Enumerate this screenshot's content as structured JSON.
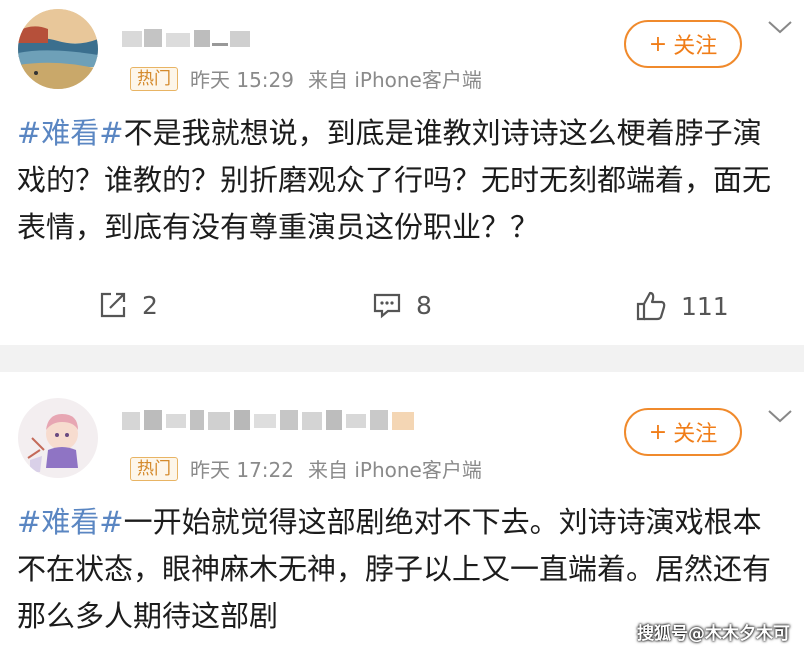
{
  "posts": [
    {
      "badge": "热门",
      "time": "昨天 15:29",
      "source": "来自 iPhone客户端",
      "follow_label": "关注",
      "hashtag": "#难看#",
      "body": "不是我就想说，到底是谁教刘诗诗这么梗着脖子演戏的？谁教的？别折磨观众了行吗？无时无刻都端着，面无表情，到底有没有尊重演员这份职业？？",
      "actions": {
        "repost": "2",
        "comment": "8",
        "like": "111"
      }
    },
    {
      "badge": "热门",
      "time": "昨天 17:22",
      "source": "来自 iPhone客户端",
      "follow_label": "关注",
      "hashtag": "#难看#",
      "body": "一开始就觉得这部剧绝对不下去。刘诗诗演戏根本不在状态，眼神麻木无神，脖子以上又一直端着。居然还有那么多人期待这部剧"
    }
  ],
  "watermark": "搜狐号@木木夕木可",
  "icons": [
    "repost-icon",
    "comment-icon",
    "like-icon",
    "chevron-down-icon",
    "plus-icon"
  ]
}
